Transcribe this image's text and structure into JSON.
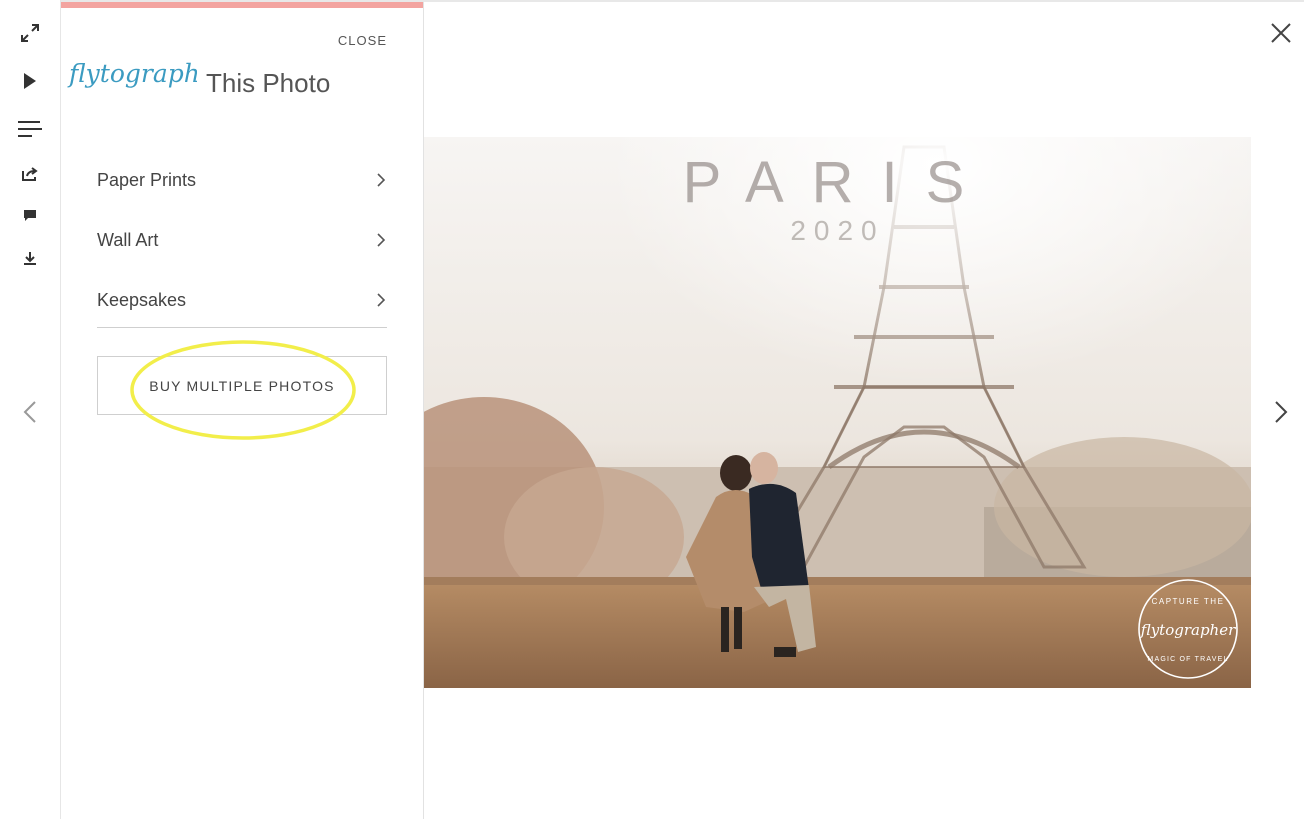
{
  "toolbar": {
    "items": [
      {
        "icon": "fullscreen-icon"
      },
      {
        "icon": "play-icon"
      },
      {
        "icon": "menu-icon"
      },
      {
        "icon": "share-icon"
      },
      {
        "icon": "comment-icon"
      },
      {
        "icon": "download-icon"
      }
    ]
  },
  "panel": {
    "close_label": "CLOSE",
    "logo_text": "flytographer",
    "title": "This Photo",
    "accent_color": "#f3a4a0",
    "menu": [
      {
        "label": "Paper Prints"
      },
      {
        "label": "Wall Art"
      },
      {
        "label": "Keepsakes"
      }
    ],
    "buy_label": "BUY MULTIPLE PHOTOS",
    "highlight_color": "#f2ee4a"
  },
  "photo": {
    "overlay_title": "PARIS",
    "overlay_year": "2020",
    "stamp_top": "CAPTURE THE",
    "stamp_logo": "flytographer",
    "stamp_bottom": "MAGIC OF TRAVEL"
  }
}
